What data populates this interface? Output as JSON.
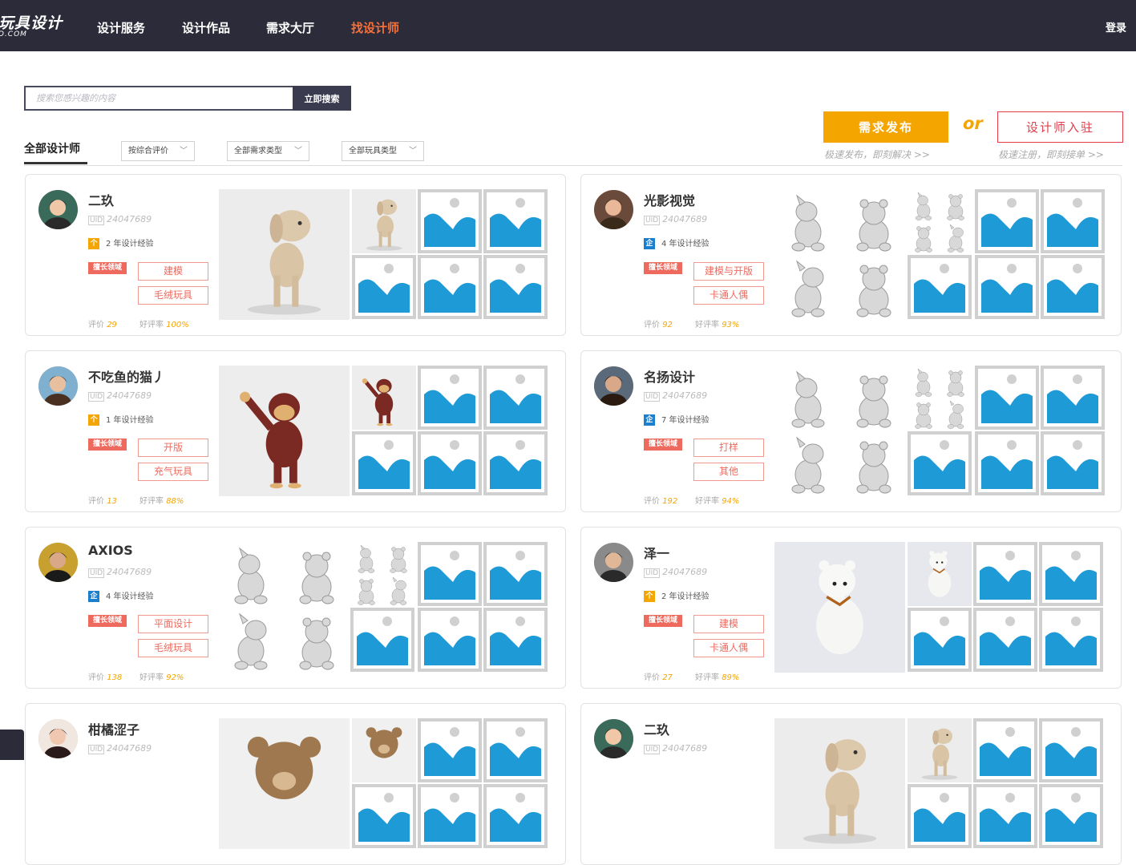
{
  "header": {
    "logo_title": "玩具设计",
    "logo_sub": "D.COM",
    "nav": [
      "设计服务",
      "设计作品",
      "需求大厅",
      "找设计师"
    ],
    "active_nav": "找设计师",
    "login": "登录"
  },
  "search": {
    "placeholder": "搜索您感兴趣的内容",
    "button": "立即搜索"
  },
  "cta": {
    "publish": "需求发布",
    "or": "or",
    "join": "设计师入驻",
    "publish_sub": "极速发布，即刻解决 >>",
    "join_sub": "极速注册，即刻接单 >>"
  },
  "filters": {
    "title": "全部设计师",
    "sort": "按综合评价",
    "demand_type": "全部需求类型",
    "toy_type": "全部玩具类型"
  },
  "labels": {
    "skill_badge": "擅长领域",
    "rating_label": "评价",
    "good_rate_label": "好评率",
    "uid_tag": "UID"
  },
  "designers": [
    {
      "name": "二玖",
      "uid": "24047689",
      "exp": "2 年设计经验",
      "exp_type": "person",
      "skills": [
        "建模",
        "毛绒玩具"
      ],
      "reviews": "29",
      "good_rate": "100%",
      "gallery": "dog"
    },
    {
      "name": "光影视觉",
      "uid": "24047689",
      "exp": "4 年设计经验",
      "exp_type": "company",
      "skills": [
        "建模与开版",
        "卡通人偶"
      ],
      "reviews": "92",
      "good_rate": "93%",
      "gallery": "sketch"
    },
    {
      "name": "不吃鱼的猫丿",
      "uid": "24047689",
      "exp": "1 年设计经验",
      "exp_type": "person",
      "skills": [
        "开版",
        "充气玩具"
      ],
      "reviews": "13",
      "good_rate": "88%",
      "gallery": "monkey"
    },
    {
      "name": "名扬设计",
      "uid": "24047689",
      "exp": "7 年设计经验",
      "exp_type": "company",
      "skills": [
        "打样",
        "其他"
      ],
      "reviews": "192",
      "good_rate": "94%",
      "gallery": "sketch"
    },
    {
      "name": "AXIOS",
      "uid": "24047689",
      "exp": "4 年设计经验",
      "exp_type": "company",
      "skills": [
        "平面设计",
        "毛绒玩具"
      ],
      "reviews": "138",
      "good_rate": "92%",
      "gallery": "sketch"
    },
    {
      "name": "泽一",
      "uid": "24047689",
      "exp": "2 年设计经验",
      "exp_type": "person",
      "skills": [
        "建模",
        "卡通人偶"
      ],
      "reviews": "27",
      "good_rate": "89%",
      "gallery": "bear"
    },
    {
      "name": "柑橘涩子",
      "uid": "24047689",
      "exp": "",
      "exp_type": "person",
      "skills": [],
      "reviews": "",
      "good_rate": "",
      "gallery": "teddy"
    },
    {
      "name": "二玖",
      "uid": "24047689",
      "exp": "",
      "exp_type": "person",
      "skills": [],
      "reviews": "",
      "good_rate": "",
      "gallery": "dog"
    }
  ],
  "colors": {
    "header_bg": "#2b2b3a",
    "active_nav": "#f5713a",
    "accent_orange": "#f5a500",
    "accent_red": "#e03c4a",
    "skill_red": "#ee6a5e",
    "placeholder_blue": "#1e9ad6"
  }
}
